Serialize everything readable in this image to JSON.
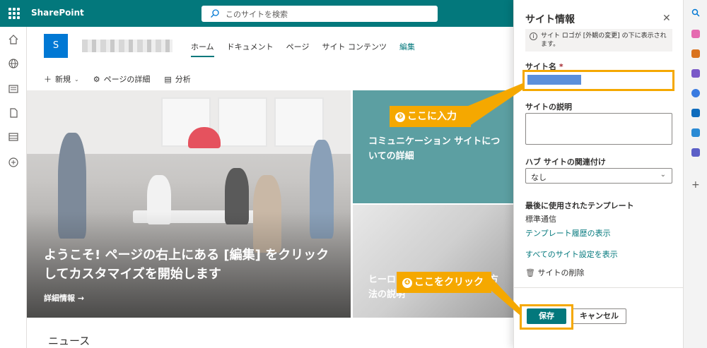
{
  "app": {
    "brand": "SharePoint"
  },
  "search": {
    "placeholder": "このサイトを検索"
  },
  "site": {
    "logo_letter": "S"
  },
  "nav": {
    "items": [
      "ホーム",
      "ドキュメント",
      "ページ",
      "サイト コンテンツ"
    ],
    "edit": "編集"
  },
  "commands": {
    "new": "新規",
    "page_details": "ページの詳細",
    "analytics": "分析"
  },
  "hero": {
    "main_title": "ようこそ! ページの右上にある [編集] をクリックしてカスタマイズを開始します",
    "main_link": "詳細情報 →",
    "tile1": "コミュニケーション サイトについての詳細",
    "tile2": "ヒーロー Web パーツの使用方法の説明"
  },
  "news": "ニュース",
  "panel": {
    "title": "サイト情報",
    "info": "サイト ロゴが [外観の変更] の下に表示されます。",
    "site_name_label": "サイト名",
    "required_mark": "*",
    "desc_label": "サイトの説明",
    "hub_label": "ハブ サイトの関連付け",
    "hub_value": "なし",
    "template_label": "最後に使用されたテンプレート",
    "template_value": "標準通信",
    "template_history_link": "テンプレート履歴の表示",
    "all_settings_link": "すべてのサイト設定を表示",
    "delete_label": "サイトの削除",
    "save": "保存",
    "cancel": "キャンセル"
  },
  "callouts": {
    "step3_num": "❸",
    "step3": "ここに入力",
    "step4_num": "❹",
    "step4": "ここをクリック"
  },
  "colors": {
    "accent": "#03787c",
    "highlight": "#f5a800",
    "tile": "#5c9fa2"
  }
}
